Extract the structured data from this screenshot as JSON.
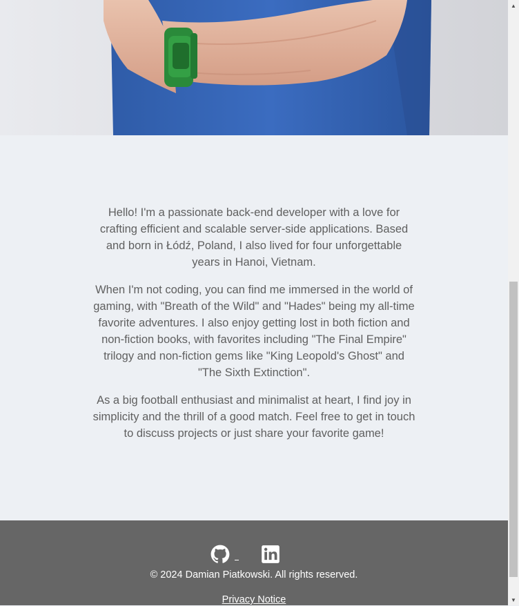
{
  "hero": {
    "alt": "Photo of Damian with arms crossed wearing a green watch"
  },
  "about": {
    "paragraphs": [
      "Hello! I'm a passionate back-end developer with a love for crafting efficient and scalable server-side applications. Based and born in Łódź, Poland, I also lived for four unforgettable years in Hanoi, Vietnam.",
      "When I'm not coding, you can find me immersed in the world of gaming, with \"Breath of the Wild\" and \"Hades\" being my all-time favorite adventures. I also enjoy getting lost in both fiction and non-fiction books, with favorites including \"The Final Empire\" trilogy and non-fiction gems like \"King Leopold's Ghost\" and \"The Sixth Extinction\".",
      "As a big football enthusiast and minimalist at heart, I find joy in simplicity and the thrill of a good match. Feel free to get in touch to discuss projects or just share your favorite game!"
    ]
  },
  "footer": {
    "socials": [
      {
        "icon": "github-icon",
        "label": "GitHub"
      },
      {
        "icon": "linkedin-icon",
        "label": "LinkedIn"
      }
    ],
    "copyright": "© 2024 Damian Piatkowski. All rights reserved.",
    "privacy_label": "Privacy Notice"
  },
  "colors": {
    "background": "#edf0f4",
    "text": "#5f5f5f",
    "footer_bg": "#666666",
    "footer_text": "#ffffff",
    "shirt_blue": "#3a67b5",
    "watch_green": "#2a8a3a"
  }
}
